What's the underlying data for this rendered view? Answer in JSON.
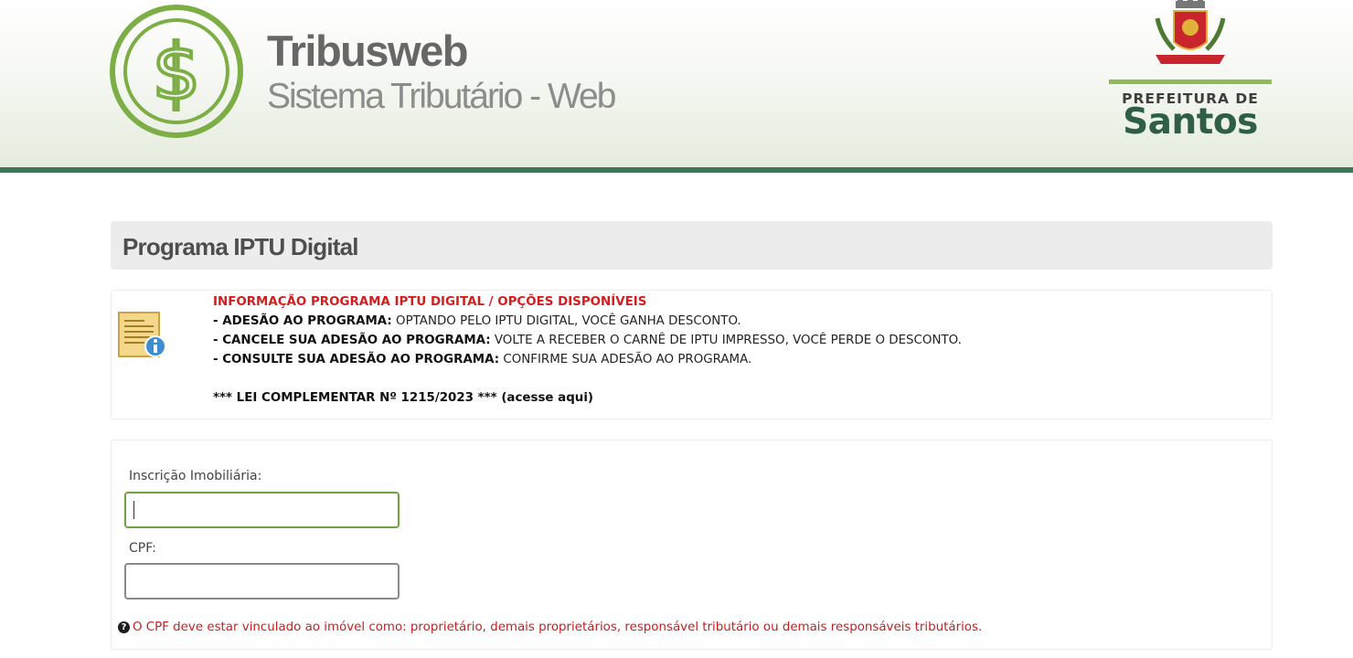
{
  "header": {
    "brand_title": "Tribusweb",
    "brand_subtitle": "Sistema Tributário - Web",
    "prefeitura_label": "PREFEITURA DE",
    "city_name": "Santos",
    "coin_icon": "dollar-coin-icon",
    "crest_icon": "city-crest-icon"
  },
  "page": {
    "title": "Programa IPTU Digital"
  },
  "info": {
    "icon": "document-info-icon",
    "headline": "INFORMAÇÃO PROGRAMA IPTU DIGITAL / OPÇÕES DISPONÍVEIS",
    "items": [
      {
        "label": "- ADESÃO AO PROGRAMA:",
        "text": " OPTANDO PELO IPTU DIGITAL, VOCÊ GANHA DESCONTO."
      },
      {
        "label": "- CANCELE SUA ADESÃO AO PROGRAMA:",
        "text": " VOLTE A RECEBER O CARNÊ DE IPTU IMPRESSO, VOCÊ PERDE O DESCONTO."
      },
      {
        "label": "- CONSULTE SUA ADESÃO AO PROGRAMA:",
        "text": " CONFIRME SUA ADESÃO AO PROGRAMA."
      }
    ],
    "law_link": "*** LEI COMPLEMENTAR Nº 1215/2023 *** (acesse aqui)"
  },
  "form": {
    "inscricao_label": "Inscrição Imobiliária:",
    "inscricao_value": "",
    "cpf_label": "CPF:",
    "cpf_value": "",
    "notice_icon": "question-circle-icon",
    "notice_text": "O CPF deve estar vinculado ao imóvel como: proprietário, demais proprietários, responsável tributário ou demais responsáveis tributários."
  },
  "colors": {
    "header_bar": "#3f7657",
    "brand_green": "#6fa33f",
    "alert_red": "#d11f1f"
  }
}
